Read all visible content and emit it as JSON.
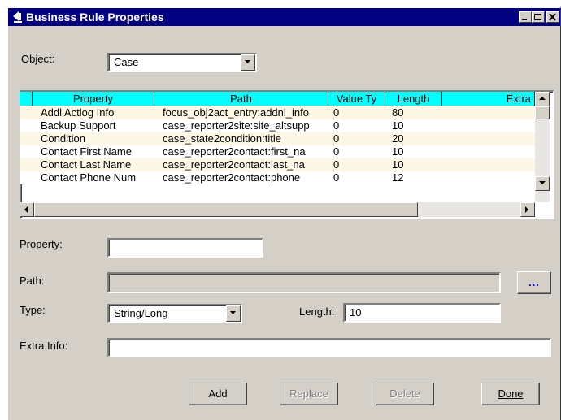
{
  "window": {
    "title": "Business Rule Properties"
  },
  "object": {
    "label": "Object:",
    "value": "Case"
  },
  "grid": {
    "columns": [
      "Property",
      "Path",
      "Value Ty",
      "Length",
      "Extra"
    ],
    "rows": [
      [
        "Addl Actlog Info",
        "focus_obj2act_entry:addnl_info",
        "0",
        "80",
        ""
      ],
      [
        "Backup Support",
        "case_reporter2site:site_altsupp",
        "0",
        "10",
        ""
      ],
      [
        "Condition",
        "case_state2condition:title",
        "0",
        "20",
        ""
      ],
      [
        "Contact First Name",
        "case_reporter2contact:first_na",
        "0",
        "10",
        ""
      ],
      [
        "Contact Last Name",
        "case_reporter2contact:last_na",
        "0",
        "10",
        ""
      ],
      [
        "Contact Phone Num",
        "case_reporter2contact:phone",
        "0",
        "12",
        ""
      ]
    ],
    "row_colors": [
      "#fdf8e6",
      "#ffffff"
    ]
  },
  "form": {
    "property_label": "Property:",
    "property_value": "",
    "path_label": "Path:",
    "path_value": "",
    "browse_label": "...",
    "type_label": "Type:",
    "type_value": "String/Long",
    "length_label": "Length:",
    "length_value": "10",
    "extra_label": "Extra Info:",
    "extra_value": ""
  },
  "buttons": {
    "add": "Add",
    "replace": "Replace",
    "delete": "Delete",
    "done": "Done"
  },
  "colors": {
    "title_bar": "#000080",
    "header": "#00ffff",
    "face": "#d4d0c8",
    "browse_dots": "#0000ff"
  }
}
